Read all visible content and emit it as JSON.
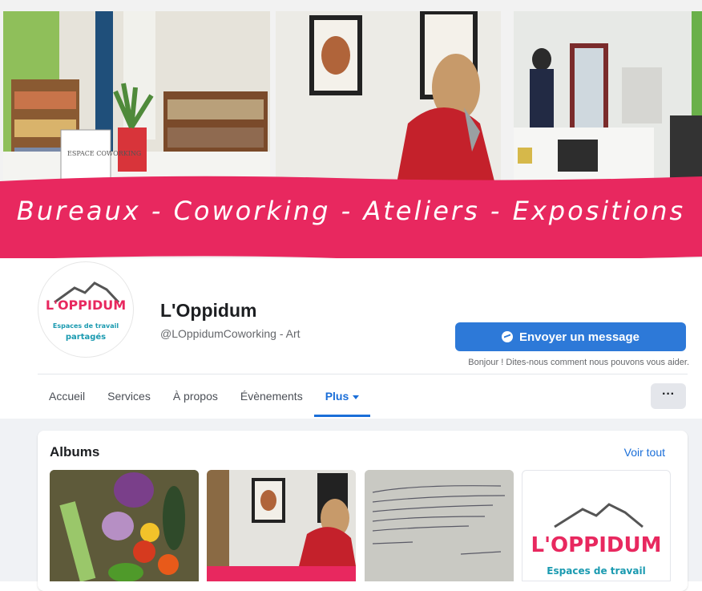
{
  "cover": {
    "banner_text": "Bureaux - Coworking - Ateliers - Expositions",
    "sign_text": "ESPACE COWORKING",
    "banner_color": "#e8285f"
  },
  "profile": {
    "logo_name": "L'OPPIDUM",
    "logo_tagline_1": "Espaces de travail",
    "logo_tagline_2": "partagés",
    "name": "L'Oppidum",
    "handle": "@LOppidumCoworking - Art"
  },
  "actions": {
    "message_button": "Envoyer un message",
    "message_icon": "messenger-icon",
    "message_hint": "Bonjour ! Dites-nous comment nous pouvons vous aider.",
    "more_button": "···"
  },
  "nav": {
    "items": [
      "Accueil",
      "Services",
      "À propos",
      "Évènements",
      "Plus"
    ],
    "active": "Plus",
    "accent": "#1a6ed8"
  },
  "albums": {
    "title": "Albums",
    "see_all": "Voir tout",
    "logo_name": "L'OPPIDUM",
    "logo_tagline": "Espaces de travail"
  }
}
